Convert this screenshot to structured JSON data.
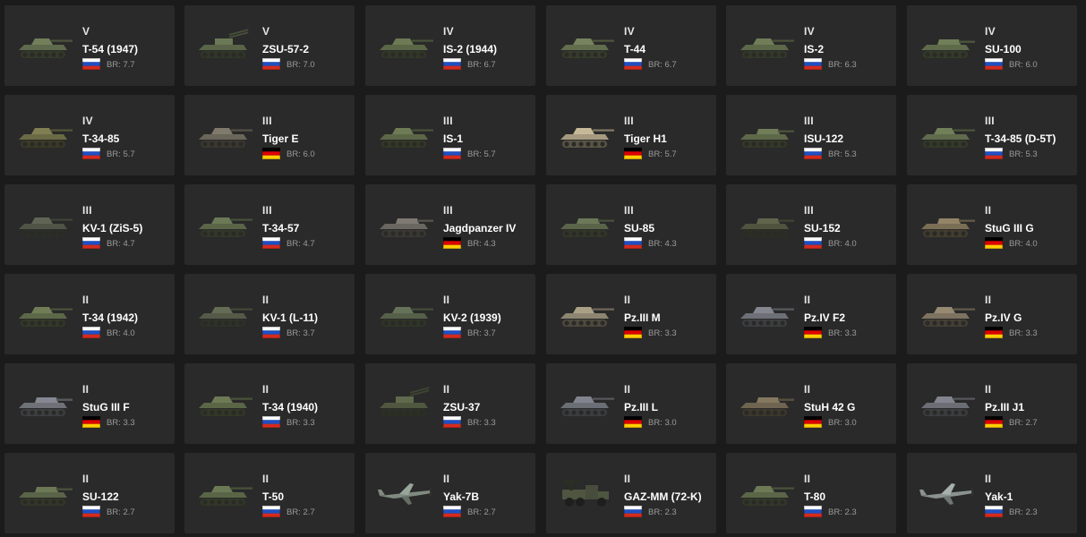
{
  "vehicles": [
    {
      "tier": "V",
      "name": "T-54 (1947)",
      "br": "BR: 7.7",
      "nation": "ussr",
      "kind": "tank",
      "color": "#5f6a4c"
    },
    {
      "tier": "V",
      "name": "ZSU-57-2",
      "br": "BR: 7.0",
      "nation": "ussr",
      "kind": "spaa",
      "color": "#596448"
    },
    {
      "tier": "IV",
      "name": "IS-2 (1944)",
      "br": "BR: 6.7",
      "nation": "ussr",
      "kind": "tank",
      "color": "#5b6646"
    },
    {
      "tier": "IV",
      "name": "T-44",
      "br": "BR: 6.7",
      "nation": "ussr",
      "kind": "tank",
      "color": "#626d4e"
    },
    {
      "tier": "IV",
      "name": "IS-2",
      "br": "BR: 6.3",
      "nation": "ussr",
      "kind": "tank",
      "color": "#5d6849"
    },
    {
      "tier": "IV",
      "name": "SU-100",
      "br": "BR: 6.0",
      "nation": "ussr",
      "kind": "td",
      "color": "#5e6a4a"
    },
    {
      "tier": "IV",
      "name": "T-34-85",
      "br": "BR: 5.7",
      "nation": "ussr",
      "kind": "tank",
      "color": "#6a6a45"
    },
    {
      "tier": "III",
      "name": "Tiger E",
      "br": "BR: 6.0",
      "nation": "germany",
      "kind": "tank",
      "color": "#6b665a"
    },
    {
      "tier": "III",
      "name": "IS-1",
      "br": "BR: 5.7",
      "nation": "ussr",
      "kind": "tank",
      "color": "#5c6747"
    },
    {
      "tier": "III",
      "name": "Tiger H1",
      "br": "BR: 5.7",
      "nation": "germany",
      "kind": "tank",
      "color": "#a59a80"
    },
    {
      "tier": "III",
      "name": "ISU-122",
      "br": "BR: 5.3",
      "nation": "ussr",
      "kind": "td",
      "color": "#5e6849"
    },
    {
      "tier": "III",
      "name": "T-34-85 (D-5T)",
      "br": "BR: 5.3",
      "nation": "ussr",
      "kind": "tank",
      "color": "#5f6b4b"
    },
    {
      "tier": "III",
      "name": "KV-1 (ZiS-5)",
      "br": "BR: 4.7",
      "nation": "ussr",
      "kind": "tank",
      "color": "#4f5446"
    },
    {
      "tier": "III",
      "name": "T-34-57",
      "br": "BR: 4.7",
      "nation": "ussr",
      "kind": "tank",
      "color": "#5a6548"
    },
    {
      "tier": "III",
      "name": "Jagdpanzer IV",
      "br": "BR: 4.3",
      "nation": "germany",
      "kind": "td",
      "color": "#6a6660"
    },
    {
      "tier": "III",
      "name": "SU-85",
      "br": "BR: 4.3",
      "nation": "ussr",
      "kind": "td",
      "color": "#5a6449"
    },
    {
      "tier": "III",
      "name": "SU-152",
      "br": "BR: 4.0",
      "nation": "ussr",
      "kind": "td",
      "color": "#50543f"
    },
    {
      "tier": "II",
      "name": "StuG III G",
      "br": "BR: 4.0",
      "nation": "germany",
      "kind": "td",
      "color": "#7a6e55"
    },
    {
      "tier": "II",
      "name": "T-34 (1942)",
      "br": "BR: 4.0",
      "nation": "ussr",
      "kind": "tank",
      "color": "#5d6848"
    },
    {
      "tier": "II",
      "name": "KV-1 (L-11)",
      "br": "BR: 3.7",
      "nation": "ussr",
      "kind": "tank",
      "color": "#545a47"
    },
    {
      "tier": "II",
      "name": "KV-2 (1939)",
      "br": "BR: 3.7",
      "nation": "ussr",
      "kind": "tank",
      "color": "#566049"
    },
    {
      "tier": "II",
      "name": "Pz.III M",
      "br": "BR: 3.3",
      "nation": "germany",
      "kind": "tank",
      "color": "#8d8570"
    },
    {
      "tier": "II",
      "name": "Pz.IV F2",
      "br": "BR: 3.3",
      "nation": "germany",
      "kind": "tank",
      "color": "#6e7078"
    },
    {
      "tier": "II",
      "name": "Pz.IV G",
      "br": "BR: 3.3",
      "nation": "germany",
      "kind": "tank",
      "color": "#7d7360"
    },
    {
      "tier": "II",
      "name": "StuG III F",
      "br": "BR: 3.3",
      "nation": "germany",
      "kind": "td",
      "color": "#6f7179"
    },
    {
      "tier": "II",
      "name": "T-34 (1940)",
      "br": "BR: 3.3",
      "nation": "ussr",
      "kind": "tank",
      "color": "#5b6647"
    },
    {
      "tier": "II",
      "name": "ZSU-37",
      "br": "BR: 3.3",
      "nation": "ussr",
      "kind": "spaa",
      "color": "#4f583f"
    },
    {
      "tier": "II",
      "name": "Pz.III L",
      "br": "BR: 3.0",
      "nation": "germany",
      "kind": "tank",
      "color": "#6c6e76"
    },
    {
      "tier": "II",
      "name": "StuH 42 G",
      "br": "BR: 3.0",
      "nation": "germany",
      "kind": "td",
      "color": "#6e6450"
    },
    {
      "tier": "II",
      "name": "Pz.III J1",
      "br": "BR: 2.7",
      "nation": "germany",
      "kind": "tank",
      "color": "#6c6e76"
    },
    {
      "tier": "II",
      "name": "SU-122",
      "br": "BR: 2.7",
      "nation": "ussr",
      "kind": "td",
      "color": "#5a6448"
    },
    {
      "tier": "II",
      "name": "T-50",
      "br": "BR: 2.7",
      "nation": "ussr",
      "kind": "tank",
      "color": "#5a6547"
    },
    {
      "tier": "II",
      "name": "Yak-7B",
      "br": "BR: 2.7",
      "nation": "ussr",
      "kind": "plane",
      "color": "#7f8a80"
    },
    {
      "tier": "II",
      "name": "GAZ-MM (72-K)",
      "br": "BR: 2.3",
      "nation": "ussr",
      "kind": "truck",
      "color": "#4e5540"
    },
    {
      "tier": "II",
      "name": "T-80",
      "br": "BR: 2.3",
      "nation": "ussr",
      "kind": "tank",
      "color": "#5b6648"
    },
    {
      "tier": "II",
      "name": "Yak-1",
      "br": "BR: 2.3",
      "nation": "ussr",
      "kind": "plane",
      "color": "#8a9390"
    }
  ],
  "flag_colors": {
    "ussr": [
      "#ffffff",
      "#1f4fc4",
      "#d52b1e"
    ],
    "germany": [
      "#000000",
      "#dd0000",
      "#ffce00"
    ]
  },
  "icons": {
    "tank": "tank-icon",
    "td": "tank-destroyer-icon",
    "spaa": "anti-aircraft-vehicle-icon",
    "truck": "truck-icon",
    "plane": "aircraft-icon"
  }
}
